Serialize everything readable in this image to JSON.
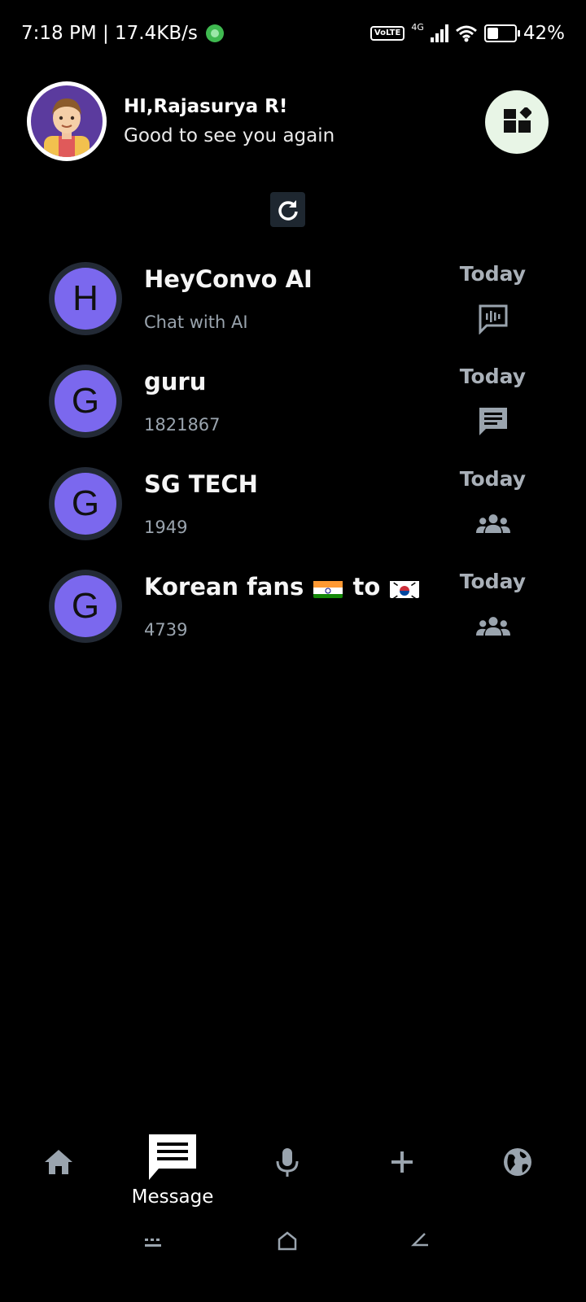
{
  "status": {
    "time_speed": "7:18 PM | 17.4KB/s",
    "network": "4G",
    "volte": "Vo LTE",
    "battery": "42%",
    "battery_level": 0.42
  },
  "header": {
    "greeting": "HI,Rajasurya R!",
    "subtitle": "Good to see you again"
  },
  "chats": [
    {
      "initial": "H",
      "name": "HeyConvo AI",
      "sub": "Chat with AI",
      "time": "Today",
      "type": "ai-voice-icon"
    },
    {
      "initial": "G",
      "name": "guru",
      "sub": "1821867",
      "time": "Today",
      "type": "message-icon"
    },
    {
      "initial": "G",
      "name": "SG TECH",
      "sub": "1949",
      "time": "Today",
      "type": "group-icon"
    },
    {
      "initial": "G",
      "name_prefix": "Korean fans",
      "name_mid": "to",
      "sub": "4739",
      "time": "Today",
      "type": "group-icon"
    }
  ],
  "bottom_nav": {
    "items": [
      "home-icon",
      "message-icon",
      "mic-icon",
      "add-icon",
      "globe-icon"
    ],
    "active_label": "Message"
  },
  "colors": {
    "accent_avatar": "#7b68ee",
    "menu_bg": "#e8f5e6",
    "muted": "#9aa4ae"
  }
}
